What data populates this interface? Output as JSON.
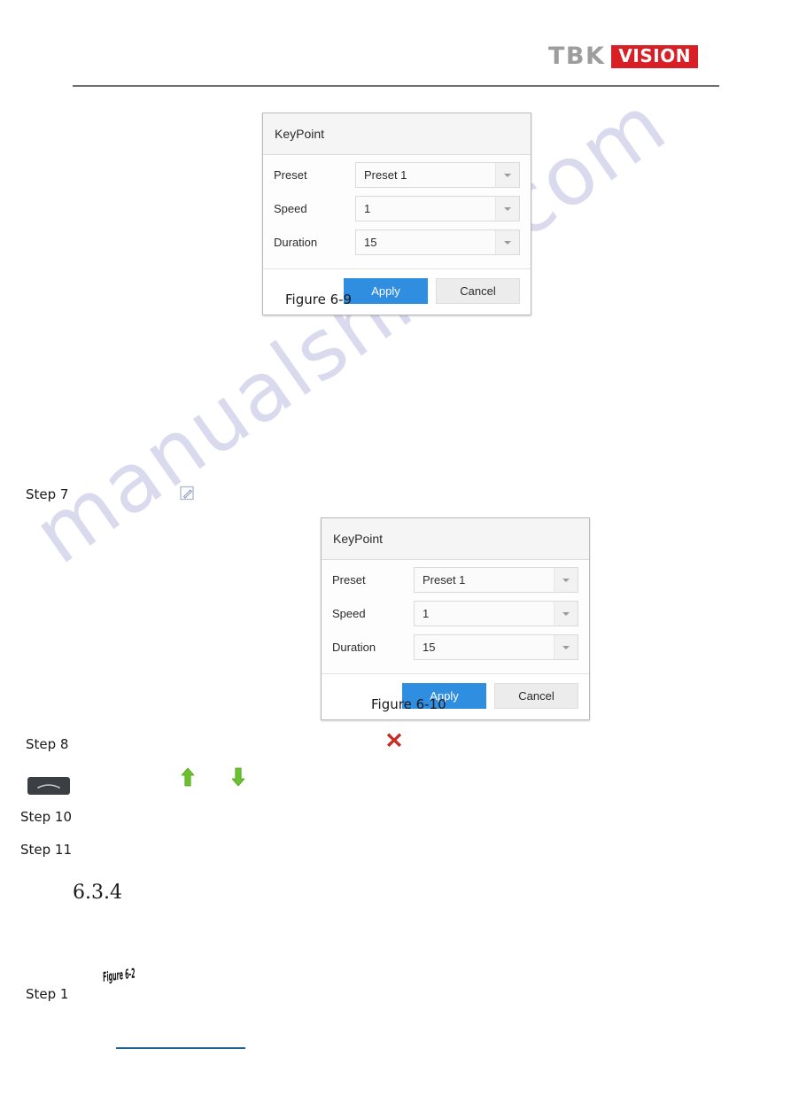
{
  "header": {
    "logo_primary": "TBK",
    "logo_secondary": "VISION",
    "logo_secondary_bg": "#d81f26",
    "logo_primary_color": "#9d9d9d"
  },
  "watermark": {
    "text": "manualshive.com",
    "color": "#ccccea"
  },
  "dialogs": [
    {
      "title": "KeyPoint",
      "rows": [
        {
          "label": "Preset",
          "value": "Preset 1",
          "icon": "chevron-down-icon"
        },
        {
          "label": "Speed",
          "value": "1",
          "icon": "chevron-down-icon"
        },
        {
          "label": "Duration",
          "value": "15",
          "icon": "chevron-down-icon"
        }
      ],
      "apply_label": "Apply",
      "cancel_label": "Cancel",
      "apply_color": "#2f8ee0",
      "caption": "Figure 6-9"
    },
    {
      "title": "KeyPoint",
      "rows": [
        {
          "label": "Preset",
          "value": "Preset 1",
          "icon": "chevron-down-icon"
        },
        {
          "label": "Speed",
          "value": "1",
          "icon": "chevron-down-icon"
        },
        {
          "label": "Duration",
          "value": "15",
          "icon": "chevron-down-icon"
        }
      ],
      "apply_label": "Apply",
      "cancel_label": "Cancel",
      "apply_color": "#2f8ee0",
      "caption": "Figure 6-10"
    }
  ],
  "steps": {
    "step7": "Step 7",
    "step8": "Step 8",
    "step10": "Step 10",
    "step11": "Step 11",
    "step1": "Step 1"
  },
  "section": {
    "number": "6.3.4"
  },
  "inline_figure_ref": "Figure 6-2",
  "icons": {
    "edit": "edit-pencil-icon",
    "delete": "red-x-delete-icon",
    "move_up": "green-up-arrow-icon",
    "move_down": "green-down-arrow-icon",
    "curve_button": "dark-curve-button-icon"
  }
}
